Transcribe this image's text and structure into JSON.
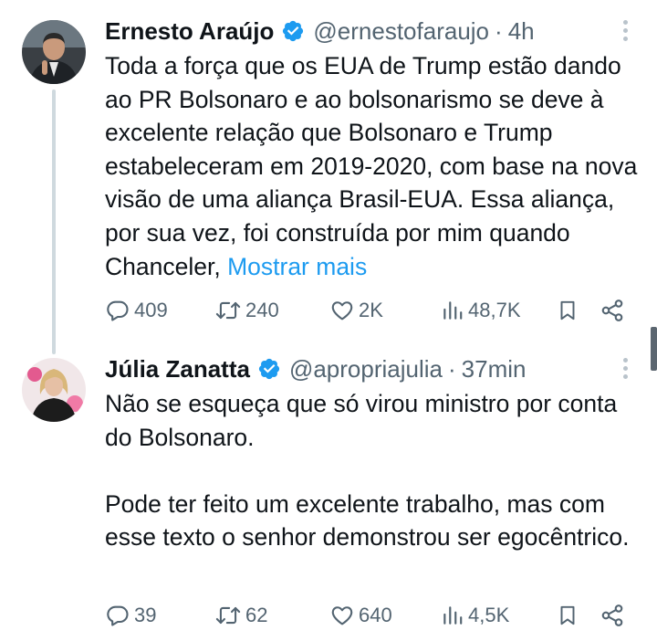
{
  "tweets": [
    {
      "author_name": "Ernesto Araújo",
      "handle": "@ernestofaraujo",
      "separator": "·",
      "time": "4h",
      "text": "Toda a força que os EUA de Trump estão dando ao PR Bolsonaro e ao bolsonarismo se deve à excelente relação que Bolsonaro e Trump estabeleceram em 2019-2020, com base na nova visão de uma aliança Brasil-EUA. Essa aliança, por sua vez, foi construída por mim quando Chanceler, ",
      "show_more": "Mostrar mais",
      "replies": "409",
      "retweets": "240",
      "likes": "2K",
      "views": "48,7K"
    },
    {
      "author_name": "Júlia Zanatta",
      "handle": "@apropriajulia",
      "separator": "·",
      "time": "37min",
      "text": "Não se esqueça que só virou ministro por conta do Bolsonaro.\n\nPode ter feito um excelente trabalho, mas com esse texto o senhor demonstrou ser egocêntrico.",
      "replies": "39",
      "retweets": "62",
      "likes": "640",
      "views": "4,5K"
    }
  ],
  "icons": {
    "reply": "reply-icon",
    "retweet": "retweet-icon",
    "like": "heart-icon",
    "views": "views-icon",
    "bookmark": "bookmark-icon",
    "share": "share-icon",
    "verified": "verified-badge-icon",
    "more": "more-options-icon"
  },
  "colors": {
    "text": "#0f1419",
    "secondary": "#536471",
    "link": "#1d9bf0",
    "verified": "#1d9bf0",
    "thread_line": "#cfd9de"
  }
}
